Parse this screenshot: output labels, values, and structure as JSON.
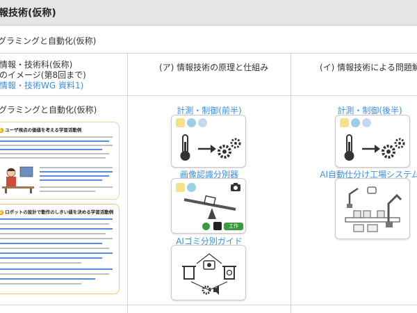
{
  "header": {
    "title": "報技術(仮称)",
    "subtitle": "グラミングと自動化(仮称)"
  },
  "columns": {
    "left_header": [
      "情報・技術科(仮称)",
      "のイメージ(第8回まで)",
      "情報・技術WG 資料1)"
    ],
    "mid_header": "(ア) 情報技術の原理と仕組み",
    "right_header": "(イ) 情報技術による問題解決"
  },
  "left_panel": {
    "title": "グラミングと自動化(仮称)",
    "doc1_heading": "ユーザ視点の価値を考える学習活動例",
    "doc2_heading": "ロボットの設計で動作のしきい値を決める学習活動例"
  },
  "mid_panel": {
    "section1_title": "計測・制御(前半)",
    "section2_title": "画像認識分別器",
    "section2_badge": "工作",
    "section3_title": "AIゴミ分別ガイド"
  },
  "right_panel": {
    "section1_title": "計測・制御(後半)",
    "section2_title": "AI自動仕分け工場システム"
  },
  "colors": {
    "accent_blue": "#3b8fe0",
    "badge_green": "#3b9a3c",
    "doc_orange": "#f0a800"
  },
  "icons": [
    "thermometer-icon",
    "arrow-right-icon",
    "gears-icon",
    "camera-icon",
    "robot-arm-icon",
    "trash-bin-icon",
    "recycle-icon",
    "speaker-icon"
  ]
}
